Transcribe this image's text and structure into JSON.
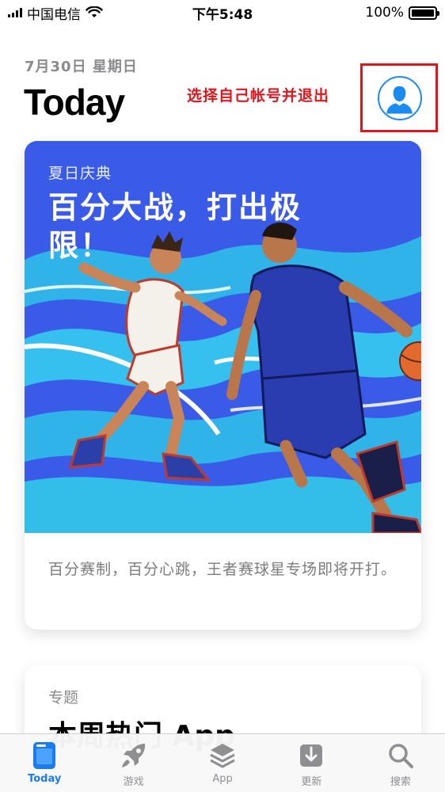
{
  "status_bar": {
    "carrier": "中国电信",
    "time": "下午5:48",
    "battery": "100%",
    "battery_level": 1.0
  },
  "header": {
    "date": "7月30日 星期日",
    "title": "Today"
  },
  "annotation": {
    "text": "选择自己帐号并退出",
    "color": "#e0161e"
  },
  "account": {
    "icon": "person-icon",
    "color": "#1a8cf0"
  },
  "story_card": {
    "eyebrow": "夏日庆典",
    "headline": "百分大战，打出极限！",
    "description": "百分赛制，百分心跳，王者赛球星专场即将开打。",
    "illustration": "basketball-players-illustration"
  },
  "second_card": {
    "eyebrow": "专题",
    "title": "本周热门 App"
  },
  "tab_bar": {
    "accent": "#1a7cf0",
    "tabs": [
      {
        "label": "Today",
        "icon": "today-icon",
        "active": true
      },
      {
        "label": "游戏",
        "icon": "rocket-icon",
        "active": false
      },
      {
        "label": "App",
        "icon": "layers-icon",
        "active": false
      },
      {
        "label": "更新",
        "icon": "download-icon",
        "active": false
      },
      {
        "label": "搜索",
        "icon": "search-icon",
        "active": false
      }
    ]
  }
}
